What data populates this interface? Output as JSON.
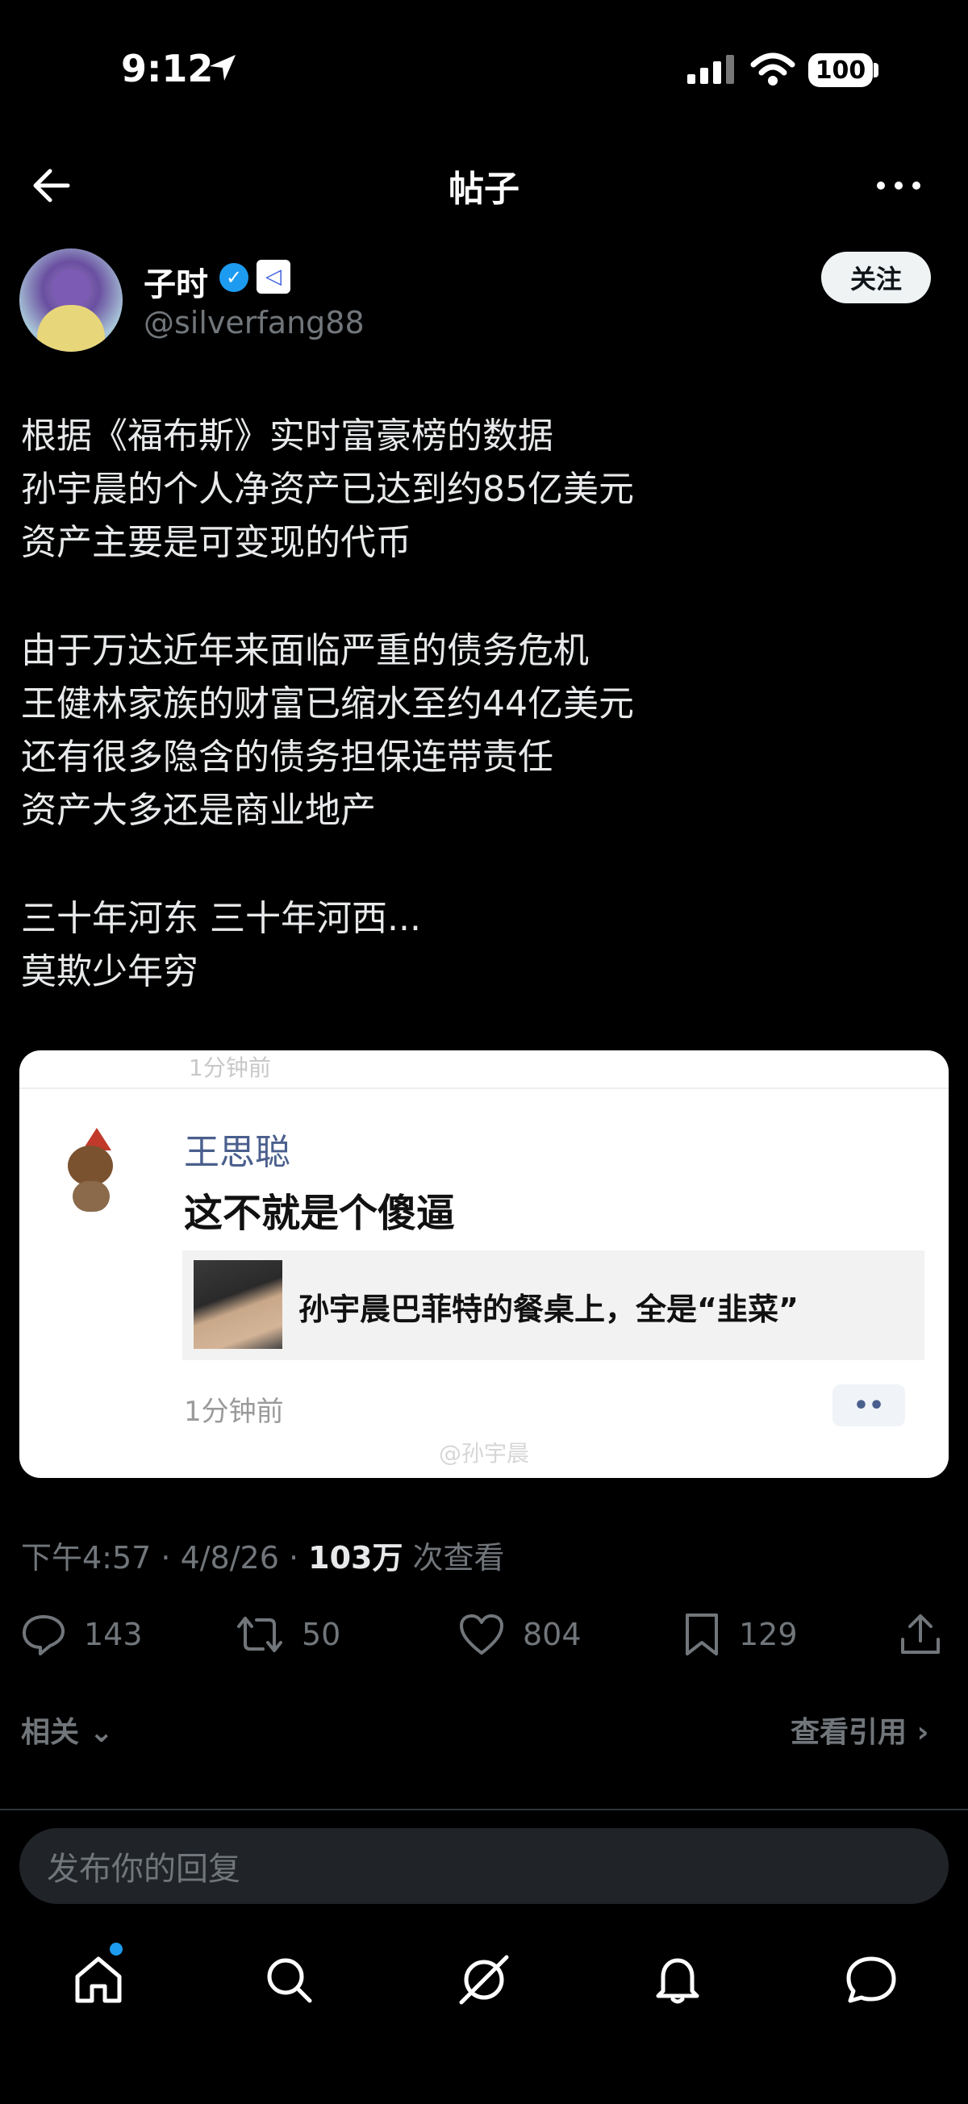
{
  "status_bar": {
    "time": "9:12",
    "battery": "100"
  },
  "header": {
    "title": "帖子"
  },
  "author": {
    "name": "子时",
    "handle": "@silverfang88",
    "follow_label": "关注"
  },
  "post": {
    "paragraphs": [
      [
        "根据《福布斯》实时富豪榜的数据",
        "孙宇晨的个人净资产已达到约85亿美元",
        "资产主要是可变现的代币"
      ],
      [
        "由于万达近年来面临严重的债务危机",
        "王健林家族的财富已缩水至约44亿美元",
        "还有很多隐含的债务担保连带责任",
        "资产大多还是商业地产"
      ],
      [
        "三十年河东 三十年河西...",
        "莫欺少年穷"
      ]
    ]
  },
  "embed": {
    "top_text": "1分钟前",
    "commenter": "王思聪",
    "comment": "这不就是个傻逼",
    "quote_text": "孙宇晨巴菲特的餐桌上，全是“韭菜”",
    "time": "1分钟前",
    "dots": "••",
    "watermark": "@孙宇晨"
  },
  "meta": {
    "prefix": "下午4:57 · 4/8/26 · ",
    "views": "103万",
    "suffix": " 次查看"
  },
  "actions": {
    "replies": "143",
    "reposts": "50",
    "likes": "804",
    "bookmarks": "129"
  },
  "related": {
    "label": "相关",
    "quotes": "查看引用"
  },
  "reply": {
    "placeholder": "发布你的回复"
  },
  "colors": {
    "accent": "#1d9bf0",
    "background": "#000000",
    "muted": "#71767b"
  }
}
